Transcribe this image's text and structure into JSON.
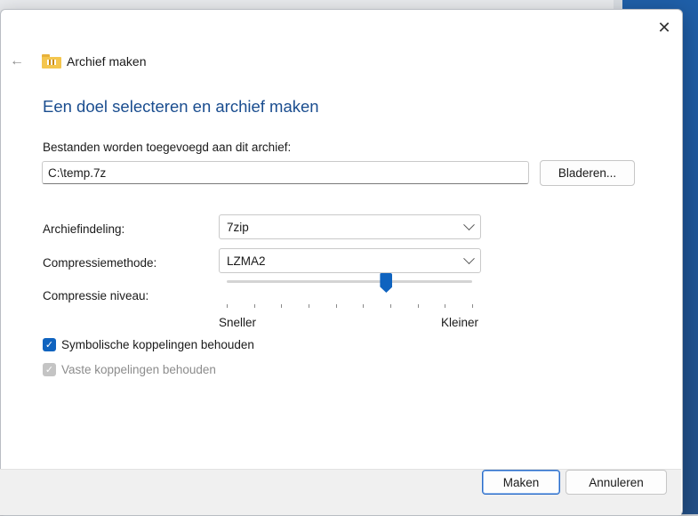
{
  "dialog": {
    "title": "Archief maken",
    "heading": "Een doel selecteren en archief maken",
    "path_label": "Bestanden worden toegevoegd aan dit archief:",
    "path_value": "C:\\temp.7z",
    "browse_label": "Bladeren...",
    "format_label": "Archiefindeling:",
    "format_value": "7zip",
    "method_label": "Compressiemethode:",
    "method_value": "LZMA2",
    "level_label": "Compressie niveau:",
    "level_min_label": "Sneller",
    "level_max_label": "Kleiner",
    "level_position": 0.65,
    "symlinks_label": "Symbolische koppelingen behouden",
    "symlinks_checked": true,
    "hardlinks_label": "Vaste koppelingen behouden",
    "hardlinks_checked": true,
    "hardlinks_disabled": true,
    "ok_label": "Maken",
    "cancel_label": "Annuleren"
  },
  "icons": {
    "close": "close-icon",
    "back": "back-arrow-icon",
    "archive": "zip-folder-icon",
    "dropdown": "chevron-down-icon",
    "check": "checkmark-icon"
  },
  "colors": {
    "heading": "#1a4d8f",
    "accent": "#0f63bf",
    "footer": "#f0f0f0"
  }
}
